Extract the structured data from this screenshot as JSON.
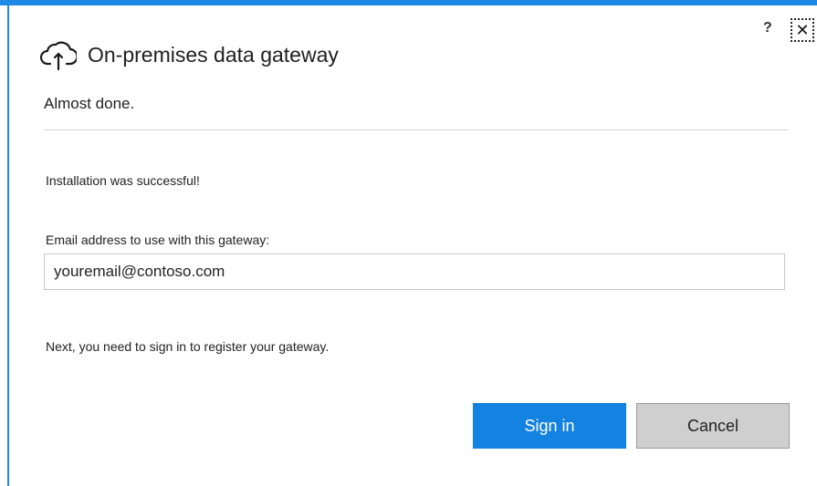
{
  "window": {
    "help_label": "?",
    "close_label": "✕"
  },
  "header": {
    "title": "On-premises data gateway",
    "subtitle": "Almost done.",
    "icon": "cloud-upload-icon"
  },
  "main": {
    "success_message": "Installation was successful!",
    "email_label": "Email address to use with this gateway:",
    "email_value": "youremail@contoso.com",
    "next_message": "Next, you need to sign in to register your gateway."
  },
  "buttons": {
    "sign_in": "Sign in",
    "cancel": "Cancel"
  },
  "colors": {
    "accent": "#1e88e5",
    "primary_button": "#1482e0",
    "secondary_button": "#cfcfcf"
  }
}
